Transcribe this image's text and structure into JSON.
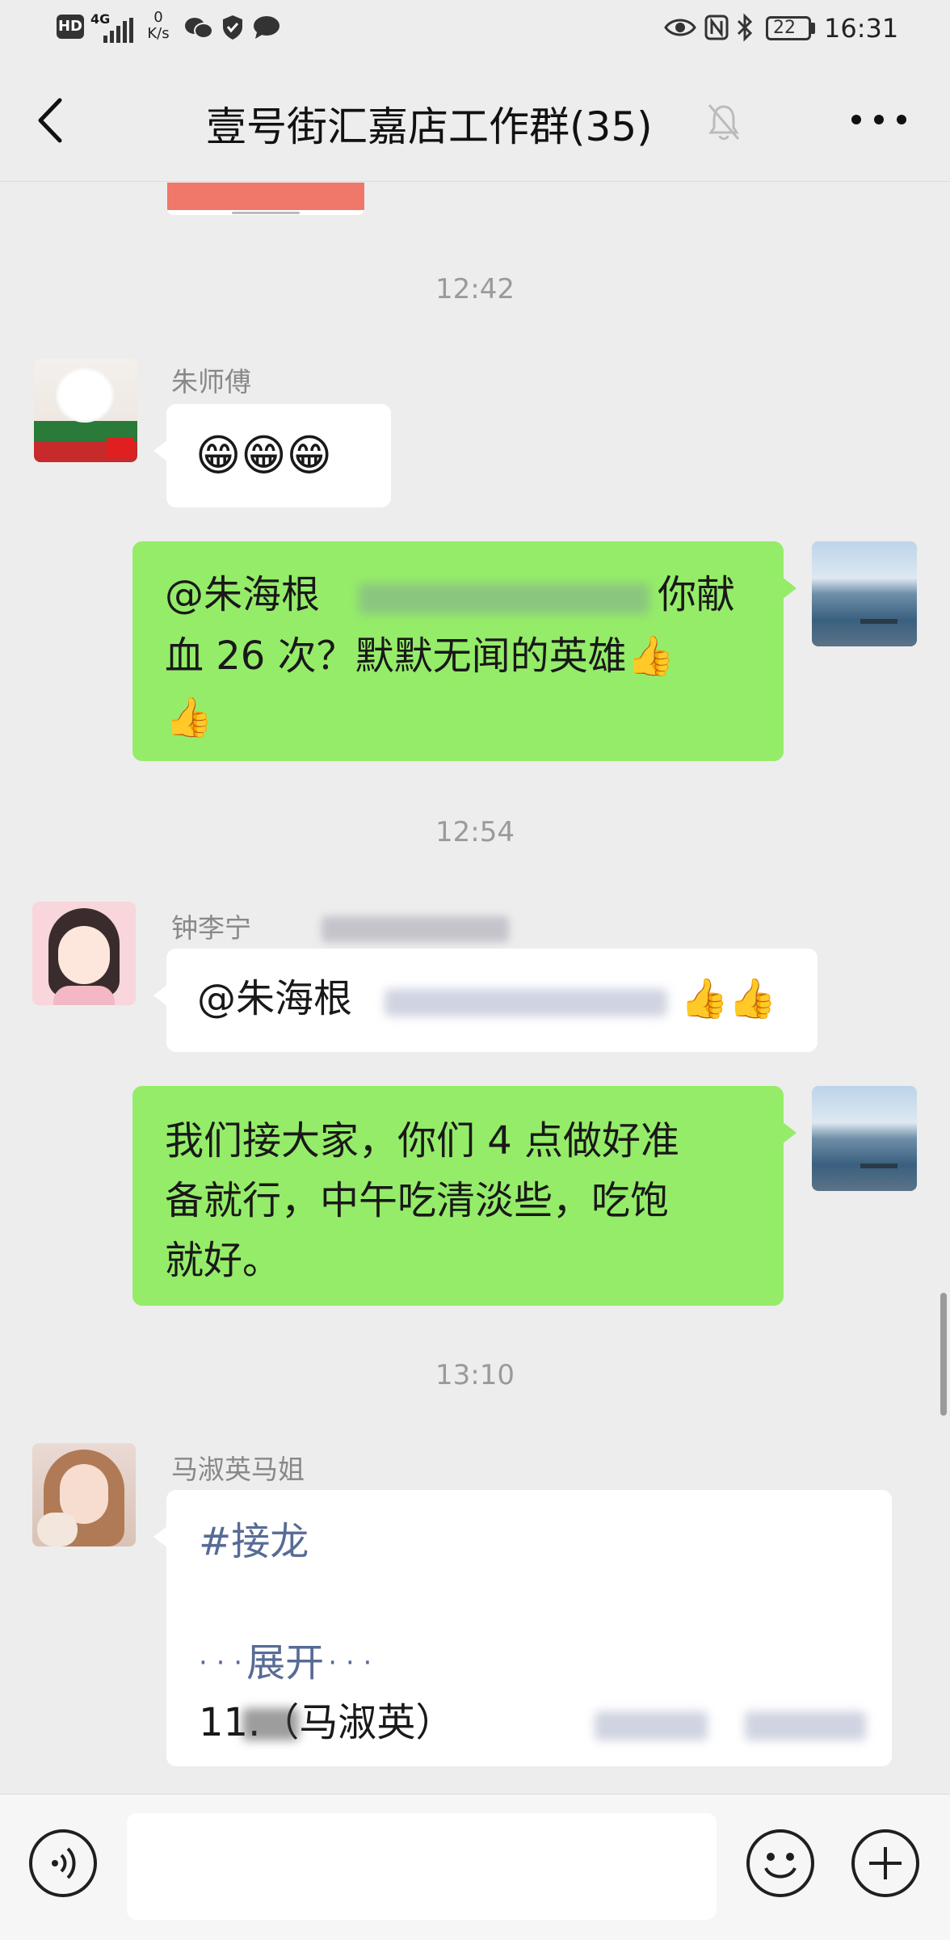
{
  "status_bar": {
    "hd": "HD",
    "net_type": "4G",
    "speed_value": "0",
    "speed_unit": "K/s",
    "battery": "22",
    "time": "16:31"
  },
  "header": {
    "title": "壹号街汇嘉店工作群(35)",
    "more": "···"
  },
  "messages": {
    "time1": "12:42",
    "msg1_sender": "朱师傅",
    "msg1_text": "😁😁😁",
    "msg2_line1_a": "@朱海根",
    "msg2_line1_b": "你献",
    "msg2_line2": "血 26 次？默默无闻的英雄👍",
    "msg2_line3": "👍",
    "time2": "12:54",
    "msg3_sender": "钟李宁",
    "msg3_text_a": "@朱海根",
    "msg3_text_b": "👍👍",
    "msg4_line1": "我们接大家，你们 4 点做好准",
    "msg4_line2": "备就行，中午吃清淡些，吃饱",
    "msg4_line3": "就好。",
    "time3": "13:10",
    "msg5_sender": "马淑英马姐",
    "msg5_tag": "#接龙",
    "msg5_dots_left": "· · ·",
    "msg5_expand": "展开",
    "msg5_dots_right": "· · ·",
    "msg5_item": "11.（马淑英）"
  },
  "colors": {
    "background": "#ededed",
    "self_bubble": "#95ec69",
    "other_bubble": "#ffffff",
    "link_blue": "#576b95"
  }
}
